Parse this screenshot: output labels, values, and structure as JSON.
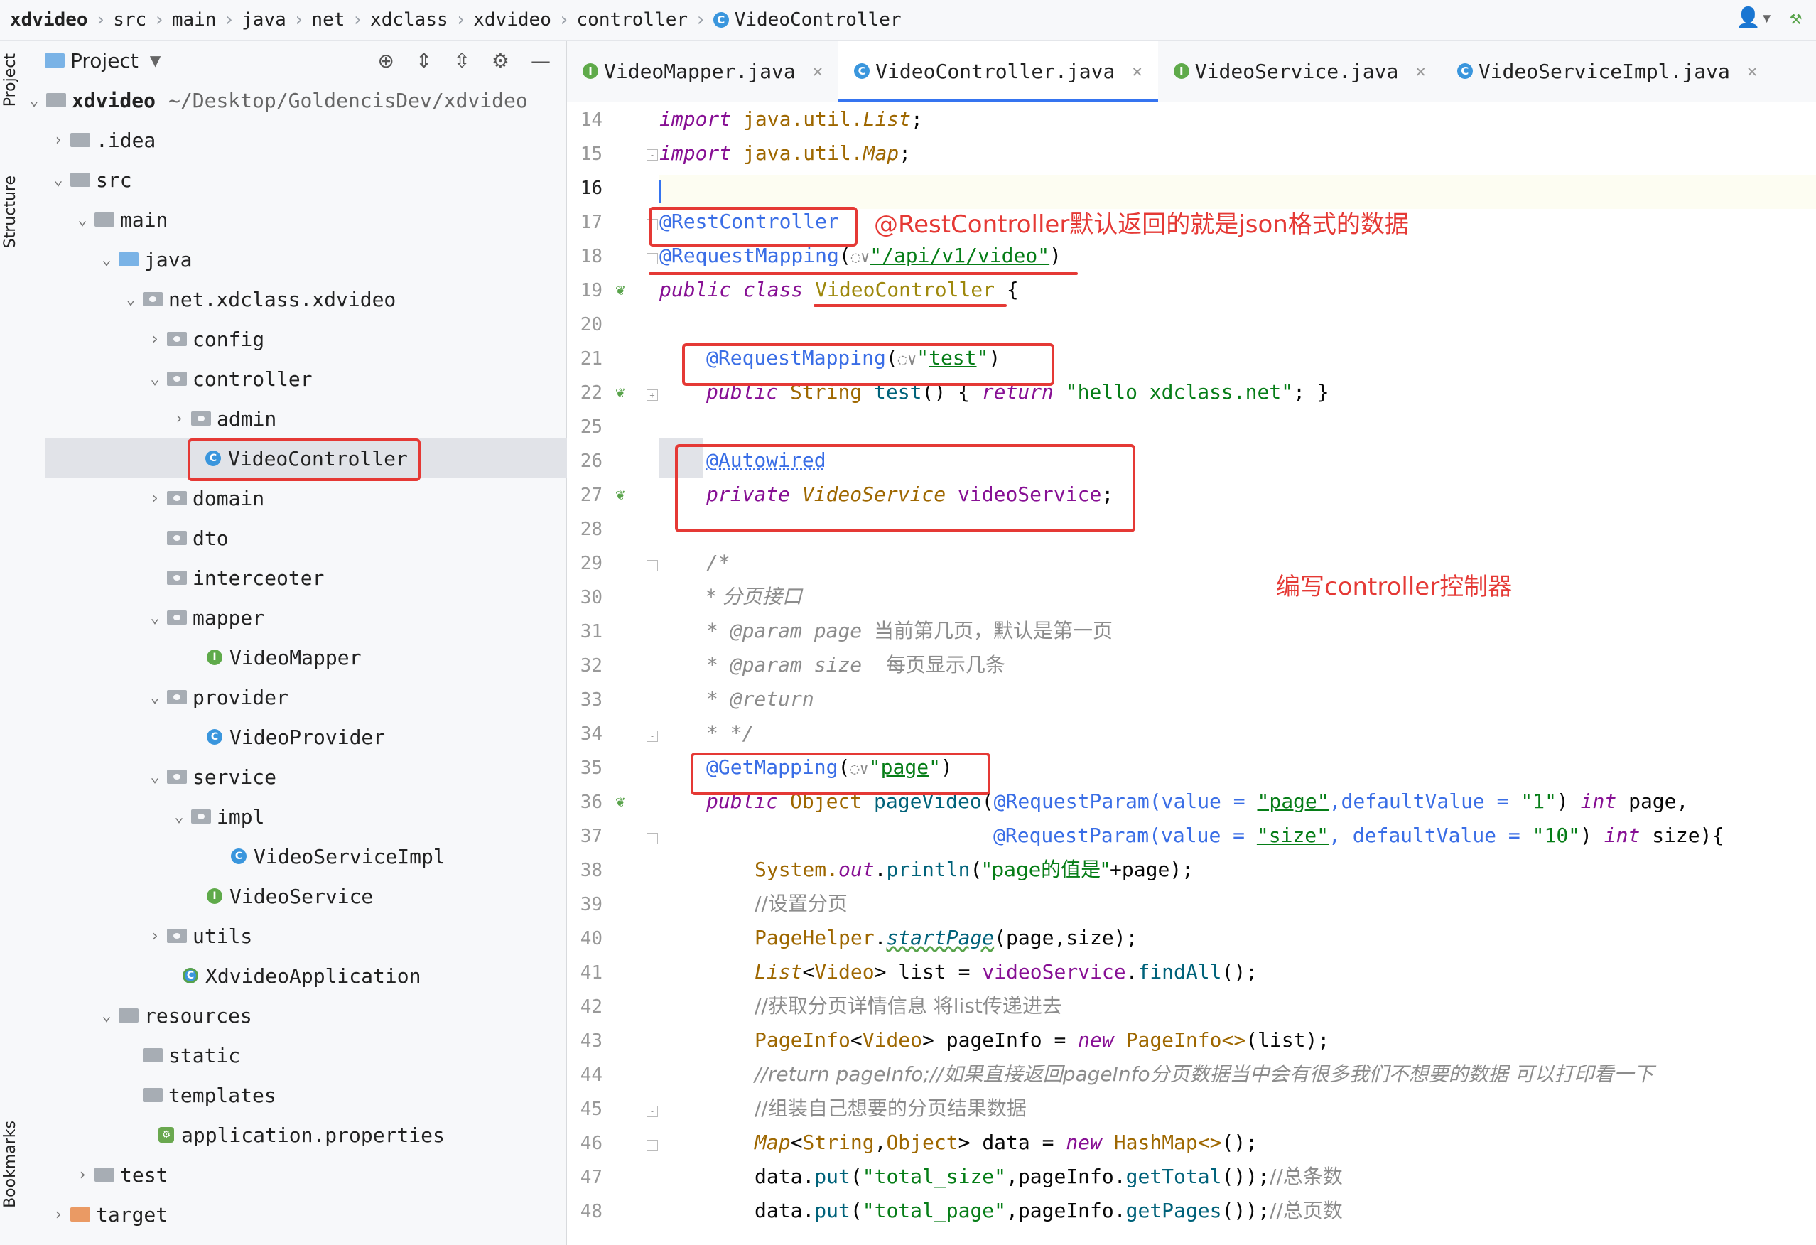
{
  "breadcrumbs": [
    "xdvideo",
    "src",
    "main",
    "java",
    "net",
    "xdclass",
    "xdvideo",
    "controller",
    "VideoController"
  ],
  "toolstrip": {
    "project": "Project",
    "structure": "Structure",
    "bookmarks": "Bookmarks"
  },
  "project_panel": {
    "title": "Project"
  },
  "tree": [
    {
      "label": "xdvideo",
      "path": "~/Desktop/GoldencisDev/xdvideo"
    },
    {
      "label": ".idea"
    },
    {
      "label": "src"
    },
    {
      "label": "main"
    },
    {
      "label": "java"
    },
    {
      "label": "net.xdclass.xdvideo"
    },
    {
      "label": "config"
    },
    {
      "label": "controller"
    },
    {
      "label": "admin"
    },
    {
      "label": "VideoController"
    },
    {
      "label": "domain"
    },
    {
      "label": "dto"
    },
    {
      "label": "interceoter"
    },
    {
      "label": "mapper"
    },
    {
      "label": "VideoMapper"
    },
    {
      "label": "provider"
    },
    {
      "label": "VideoProvider"
    },
    {
      "label": "service"
    },
    {
      "label": "impl"
    },
    {
      "label": "VideoServiceImpl"
    },
    {
      "label": "VideoService"
    },
    {
      "label": "utils"
    },
    {
      "label": "XdvideoApplication"
    },
    {
      "label": "resources"
    },
    {
      "label": "static"
    },
    {
      "label": "templates"
    },
    {
      "label": "application.properties"
    },
    {
      "label": "test"
    },
    {
      "label": "target"
    }
  ],
  "tabs": [
    {
      "label": "VideoMapper.java",
      "icon": "I"
    },
    {
      "label": "VideoController.java",
      "icon": "C"
    },
    {
      "label": "VideoService.java",
      "icon": "I"
    },
    {
      "label": "VideoServiceImpl.java",
      "icon": "C"
    }
  ],
  "line_numbers": [
    "14",
    "15",
    "16",
    "17",
    "18",
    "19",
    "20",
    "21",
    "22",
    "25",
    "26",
    "27",
    "28",
    "29",
    "30",
    "31",
    "32",
    "33",
    "34",
    "35",
    "36",
    "37",
    "38",
    "39",
    "40",
    "41",
    "42",
    "43",
    "44",
    "45",
    "46",
    "47",
    "48"
  ],
  "code": {
    "l14": [
      "import ",
      "java.util.",
      "List",
      ";"
    ],
    "l15": [
      "import ",
      "java.util.",
      "Map",
      ";"
    ],
    "l17": "@RestController",
    "l18": [
      "@RequestMapping",
      "(",
      "◌∨",
      "\"/api/v1/video\"",
      ")"
    ],
    "l19": [
      "public class ",
      "VideoController",
      " {"
    ],
    "l21": [
      "@RequestMapping",
      "(",
      "◌∨",
      "\"",
      "test",
      "\"",
      ")"
    ],
    "l22": [
      "public ",
      "String ",
      "test",
      "() { ",
      "return ",
      "\"hello xdclass.net\"",
      "; }"
    ],
    "l26": "@Autowired",
    "l27": [
      "private ",
      "VideoService ",
      "videoService",
      ";"
    ],
    "l29": "/*",
    "l30": "* 分页接口",
    "l31": [
      "* ",
      "@param ",
      "page ",
      "当前第几页，默认是第一页"
    ],
    "l32": [
      "* ",
      "@param ",
      "size  ",
      "每页显示几条"
    ],
    "l33": [
      "* ",
      "@return"
    ],
    "l34": "* */",
    "l35": [
      "@GetMapping",
      "(",
      "◌∨",
      "\"",
      "page",
      "\"",
      ")"
    ],
    "l36": [
      "public ",
      "Object ",
      "pageVideo",
      "(",
      "@RequestParam",
      "(value = ",
      "\"page\"",
      ",defaultValue = ",
      "\"1\"",
      ") ",
      "int ",
      "page,"
    ],
    "l37": [
      "@RequestParam",
      "(value = ",
      "\"size\"",
      ", defaultValue = ",
      "\"10\"",
      ") ",
      "int ",
      "size){"
    ],
    "l38": [
      "System.",
      "out",
      ".",
      "println",
      "(",
      "\"page的值是\"",
      "+page);"
    ],
    "l39": "//设置分页",
    "l40": [
      "PageHelper",
      ".",
      "startPage",
      "(page,size);"
    ],
    "l41": [
      "List",
      "<",
      "Video",
      "> list = ",
      "videoService",
      ".",
      "findAll",
      "();"
    ],
    "l42": "//获取分页详情信息 将list传递进去",
    "l43": [
      "PageInfo",
      "<",
      "Video",
      "> pageInfo = ",
      "new ",
      "PageInfo<>",
      "(list);"
    ],
    "l44": "//return pageInfo;//如果直接返回pageInfo分页数据当中会有很多我们不想要的数据 可以打印看一下",
    "l45": "//组装自己想要的分页结果数据",
    "l46": [
      "Map",
      "<",
      "String",
      ",",
      "Object",
      "> data = ",
      "new ",
      "HashMap<>",
      "();"
    ],
    "l47": [
      "data.",
      "put",
      "(",
      "\"total_size\"",
      ",pageInfo.",
      "getTotal",
      "());",
      "//总条数"
    ],
    "l48": [
      "data.",
      "put",
      "(",
      "\"total_page\"",
      ",pageInfo.",
      "getPages",
      "());",
      "//总页数"
    ]
  },
  "annotations": {
    "note1": "@RestController默认返回的就是json格式的数据",
    "note2": "编写controller控制器"
  },
  "colors": {
    "annotation_red": "#e53935",
    "accent_blue": "#3574f0"
  }
}
